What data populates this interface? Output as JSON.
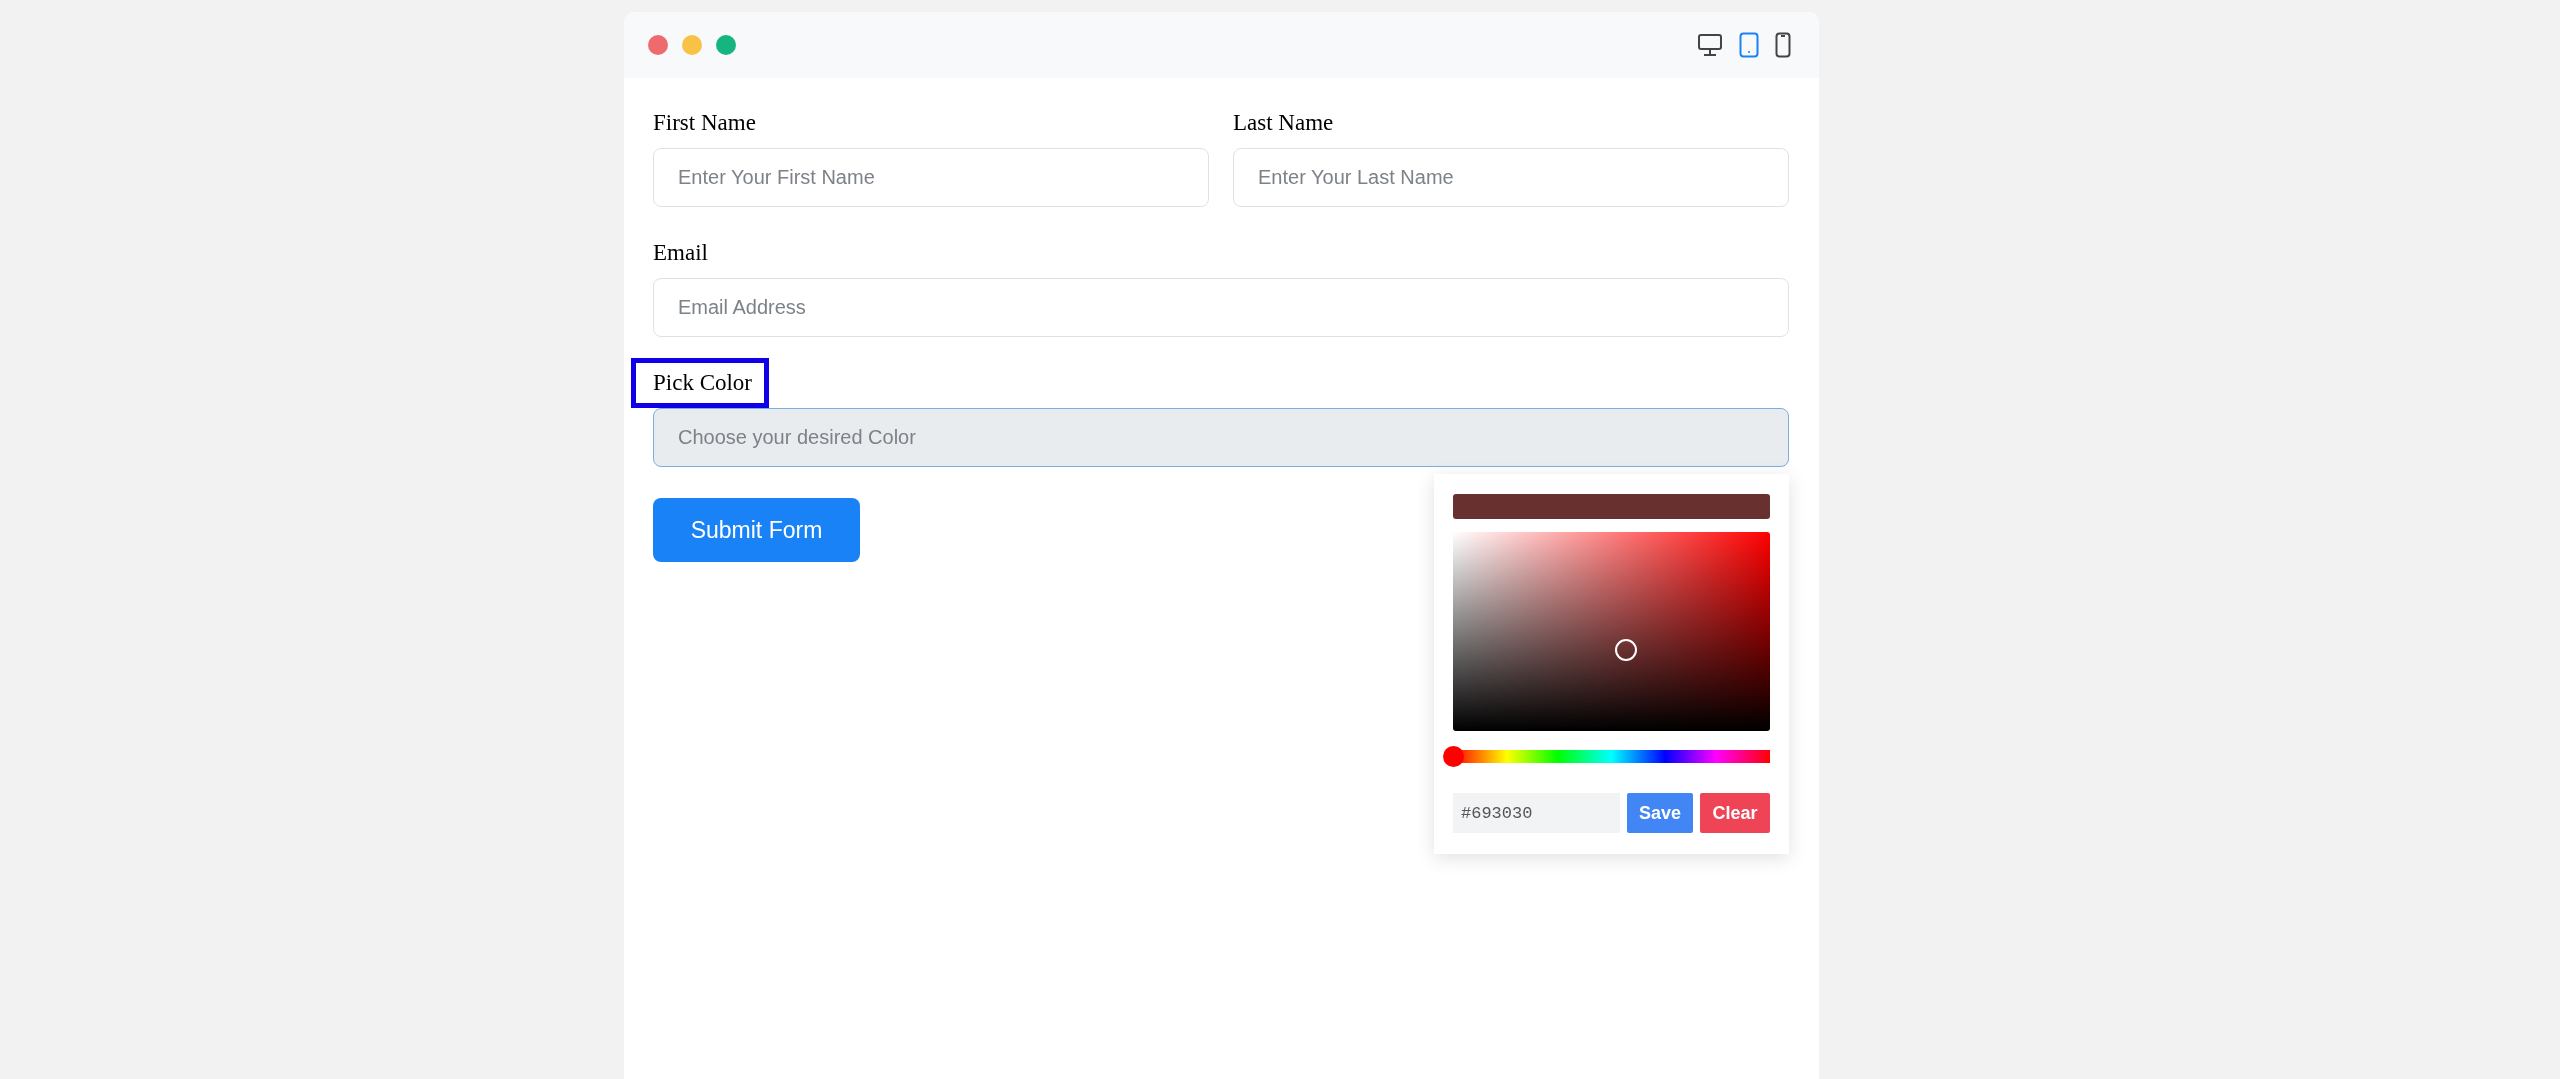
{
  "window": {
    "dots": [
      {
        "color": "#ee6a6f"
      },
      {
        "color": "#f8c246"
      },
      {
        "color": "#16b57f"
      }
    ],
    "devices": [
      {
        "kind": "desktop",
        "selected": false
      },
      {
        "kind": "tablet",
        "selected": true
      },
      {
        "kind": "phone",
        "selected": false
      }
    ]
  },
  "form": {
    "rows": [
      {
        "fields": [
          {
            "label": "First Name",
            "placeholder": "Enter Your First Name",
            "kind": "text",
            "highlighted": false
          },
          {
            "label": "Last Name",
            "placeholder": "Enter Your Last Name",
            "kind": "text",
            "highlighted": false
          }
        ]
      },
      {
        "fields": [
          {
            "label": "Email",
            "placeholder": "Email Address",
            "kind": "text",
            "highlighted": false
          }
        ]
      },
      {
        "fields": [
          {
            "label": "Pick Color",
            "placeholder": "Choose your desired Color",
            "kind": "color",
            "highlighted": true
          }
        ]
      }
    ],
    "submit": "Submit Form"
  },
  "color_picker": {
    "hue_slider": {
      "level": 0
    },
    "hex_value": "#693030",
    "buttons": [
      {
        "label": "Save",
        "kind": "save"
      },
      {
        "label": "Clear",
        "kind": "clear"
      }
    ]
  }
}
